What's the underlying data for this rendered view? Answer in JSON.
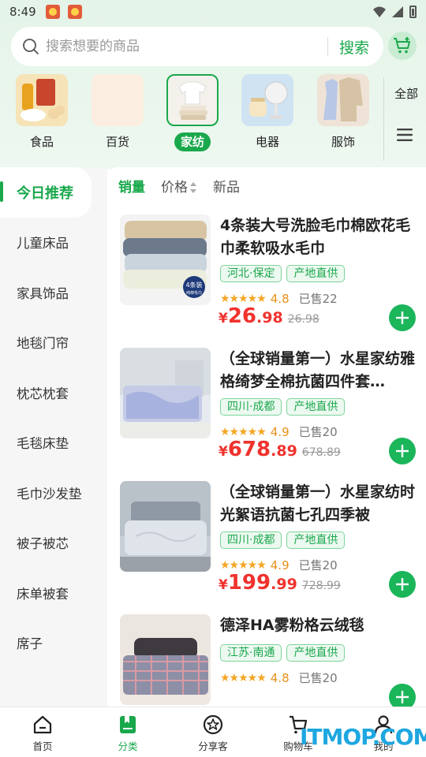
{
  "status": {
    "time": "8:49"
  },
  "search": {
    "placeholder": "搜索想要的商品",
    "button": "搜索"
  },
  "categories": [
    {
      "label": "食品"
    },
    {
      "label": "百货"
    },
    {
      "label": "家纺"
    },
    {
      "label": "电器"
    },
    {
      "label": "服饰"
    }
  ],
  "category_all": "全部",
  "sidebar": {
    "items": [
      {
        "label": "今日推荐"
      },
      {
        "label": "儿童床品"
      },
      {
        "label": "家具饰品"
      },
      {
        "label": "地毯门帘"
      },
      {
        "label": "枕芯枕套"
      },
      {
        "label": "毛毯床垫"
      },
      {
        "label": "毛巾沙发垫"
      },
      {
        "label": "被子被芯"
      },
      {
        "label": "床单被套"
      },
      {
        "label": "席子"
      }
    ]
  },
  "sort": {
    "sales": "销量",
    "price": "价格",
    "new": "新品"
  },
  "products": [
    {
      "title": "4条装大号洗脸毛巾棉欧花毛巾柔软吸水毛巾",
      "tag1": "河北·保定",
      "tag2": "产地直供",
      "stars": "★★★★★",
      "rating": "4.8",
      "sold": "已售22",
      "currency": "¥",
      "price_int": "26",
      "price_dec": ".98",
      "price_orig": "26.98",
      "badge": "4条装",
      "badge_sub": "纯棉毛巾"
    },
    {
      "title": "（全球销量第一）水星家纺雅格绮梦全棉抗菌四件套…",
      "tag1": "四川·成都",
      "tag2": "产地直供",
      "stars": "★★★★★",
      "rating": "4.9",
      "sold": "已售20",
      "currency": "¥",
      "price_int": "678",
      "price_dec": ".89",
      "price_orig": "678.89"
    },
    {
      "title": "（全球销量第一）水星家纺时光絮语抗菌七孔四季被",
      "tag1": "四川·成都",
      "tag2": "产地直供",
      "stars": "★★★★★",
      "rating": "4.9",
      "sold": "已售20",
      "currency": "¥",
      "price_int": "199",
      "price_dec": ".99",
      "price_orig": "728.99"
    },
    {
      "title": "德泽HA雾粉格云绒毯",
      "tag1": "江苏·南通",
      "tag2": "产地直供",
      "stars": "★★★★★",
      "rating": "4.8",
      "sold": "已售20"
    }
  ],
  "nav": {
    "home": "首页",
    "category": "分类",
    "share": "分享客",
    "cart": "购物车",
    "mine": "我的"
  },
  "watermark": "ITMOP.COM",
  "colors": {
    "accent": "#1aa84c",
    "price": "#f0322d",
    "star": "#f5a623"
  }
}
